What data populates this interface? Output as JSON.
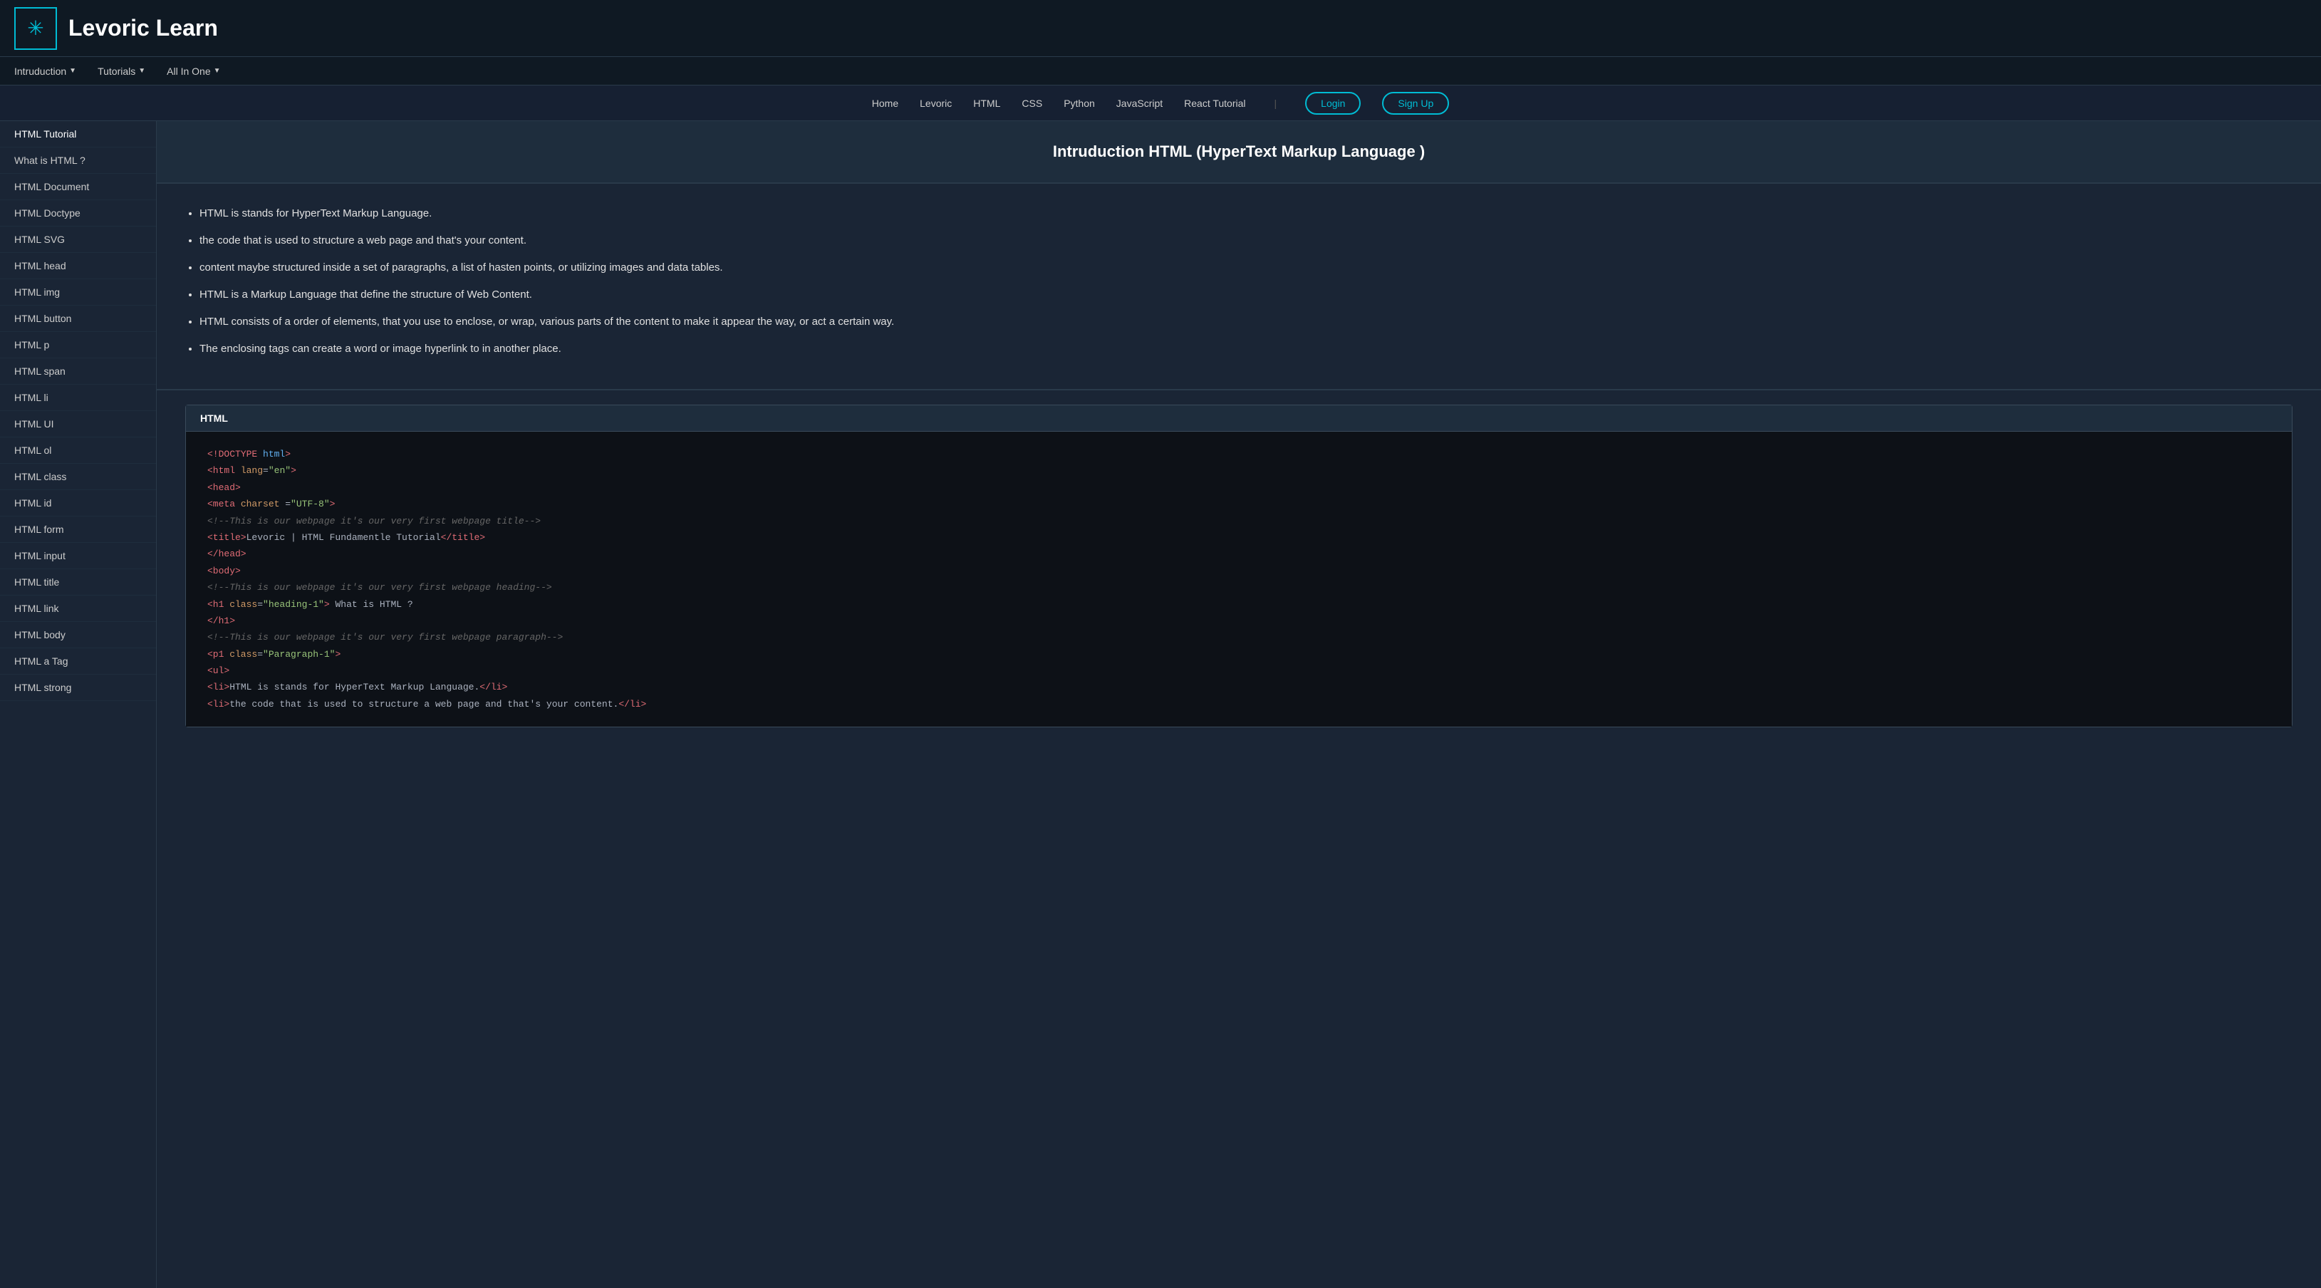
{
  "brand": {
    "logo_symbol": "✳",
    "title": "Levoric Learn"
  },
  "sub_nav": {
    "items": [
      {
        "label": "Intruduction",
        "has_dropdown": true
      },
      {
        "label": "Tutorials",
        "has_dropdown": true
      },
      {
        "label": "All In One",
        "has_dropdown": true
      }
    ]
  },
  "second_nav": {
    "links": [
      "Home",
      "Levoric",
      "HTML",
      "CSS",
      "Python",
      "JavaScript",
      "React Tutorial"
    ],
    "login_label": "Login",
    "signup_label": "Sign Up"
  },
  "sidebar": {
    "items": [
      "HTML Tutorial",
      "What is HTML ?",
      "HTML Document",
      "HTML Doctype",
      "HTML SVG",
      "HTML head",
      "HTML img",
      "HTML button",
      "HTML p",
      "HTML span",
      "HTML li",
      "HTML UI",
      "HTML ol",
      "HTML class",
      "HTML id",
      "HTML form",
      "HTML input",
      "HTML title",
      "HTML link",
      "HTML body",
      "HTML a Tag",
      "HTML strong"
    ]
  },
  "content": {
    "title": "Intruduction HTML (HyperText Markup Language )",
    "bullets": [
      "HTML is stands for HyperText Markup Language.",
      "the code that is used to structure a web page and that's your content.",
      "content maybe structured inside a set of paragraphs, a list of hasten points, or utilizing images and data tables.",
      "HTML is a Markup Language that define the structure of Web Content.",
      "HTML consists of a order of elements, that you use to enclose, or wrap, various parts of the content to make it appear the way, or act a certain way.",
      "The enclosing tags can create a word or image hyperlink to in another place."
    ]
  },
  "code_block": {
    "label": "HTML",
    "lines": [
      {
        "text": "<!DOCTYPE html>",
        "parts": [
          {
            "c": "c-tag",
            "t": "<!DOCTYPE"
          },
          {
            "c": "c-blue",
            "t": " html"
          },
          {
            "c": "c-tag",
            "t": ">"
          }
        ]
      },
      {
        "text": "<html lang=\"en\">",
        "parts": [
          {
            "c": "c-tag",
            "t": "<html"
          },
          {
            "c": "c-attr",
            "t": " lang"
          },
          {
            "c": "c-white",
            "t": "="
          },
          {
            "c": "c-str",
            "t": "\"en\""
          },
          {
            "c": "c-tag",
            "t": ">"
          }
        ]
      },
      {
        "text": "<head>",
        "parts": [
          {
            "c": "c-tag",
            "t": "<head>"
          }
        ]
      },
      {
        "text": "<meta charset =\"UTF-8\">",
        "parts": [
          {
            "c": "c-tag",
            "t": "<meta"
          },
          {
            "c": "c-attr",
            "t": " charset"
          },
          {
            "c": "c-white",
            "t": " ="
          },
          {
            "c": "c-str",
            "t": "\"UTF-8\""
          },
          {
            "c": "c-tag",
            "t": ">"
          }
        ]
      },
      {
        "text": "<!--This is our webpage it's our very first webpage title-->",
        "parts": [
          {
            "c": "c-comment",
            "t": "<!--This is our webpage it's our very first webpage title-->"
          }
        ]
      },
      {
        "text": "<title>Levoric | HTML Fundamentle Tutorial</title>",
        "parts": [
          {
            "c": "c-tag",
            "t": "<title>"
          },
          {
            "c": "c-white",
            "t": "Levoric | HTML Fundamentle Tutorial"
          },
          {
            "c": "c-tag",
            "t": "</title>"
          }
        ]
      },
      {
        "text": "</head>",
        "parts": [
          {
            "c": "c-tag",
            "t": "</head>"
          }
        ]
      },
      {
        "text": "<body>",
        "parts": [
          {
            "c": "c-tag",
            "t": "<body>"
          }
        ]
      },
      {
        "text": "<!--This is our webpage it's our very first webpage heading-->",
        "parts": [
          {
            "c": "c-comment",
            "t": "<!--This is our webpage it's our very first webpage heading-->"
          }
        ]
      },
      {
        "text": "<h1 class=\"heading-1\"> What is HTML ?",
        "parts": [
          {
            "c": "c-tag",
            "t": "<h1"
          },
          {
            "c": "c-attr",
            "t": " class"
          },
          {
            "c": "c-white",
            "t": "="
          },
          {
            "c": "c-str",
            "t": "\"heading-1\""
          },
          {
            "c": "c-tag",
            "t": ">"
          },
          {
            "c": "c-white",
            "t": " What is HTML ?"
          }
        ]
      },
      {
        "text": "</h1>",
        "parts": [
          {
            "c": "c-tag",
            "t": "</h1>"
          }
        ]
      },
      {
        "text": "<!--This is our webpage it's our very first webpage paragraph-->",
        "parts": [
          {
            "c": "c-comment",
            "t": "<!--This is our webpage it's our very first webpage paragraph-->"
          }
        ]
      },
      {
        "text": "<p1 class=\"Paragraph-1\">",
        "parts": [
          {
            "c": "c-tag",
            "t": "<p1"
          },
          {
            "c": "c-attr",
            "t": " class"
          },
          {
            "c": "c-white",
            "t": "="
          },
          {
            "c": "c-str",
            "t": "\"Paragraph-1\""
          },
          {
            "c": "c-tag",
            "t": ">"
          }
        ]
      },
      {
        "text": "<ul>",
        "parts": [
          {
            "c": "c-tag",
            "t": "<ul>"
          }
        ]
      },
      {
        "text": "<li>HTML is stands for HyperText Markup Language.</li>",
        "parts": [
          {
            "c": "c-tag",
            "t": "<li>"
          },
          {
            "c": "c-white",
            "t": "HTML is stands for HyperText Markup Language."
          },
          {
            "c": "c-tag",
            "t": "</li>"
          }
        ]
      },
      {
        "text": "<li>the code that is used to structure a web page and that's your content.</li>",
        "parts": [
          {
            "c": "c-tag",
            "t": "<li>"
          },
          {
            "c": "c-white",
            "t": "the code that is used to structure a web page and that's your content."
          },
          {
            "c": "c-tag",
            "t": "</li>"
          }
        ]
      }
    ]
  }
}
